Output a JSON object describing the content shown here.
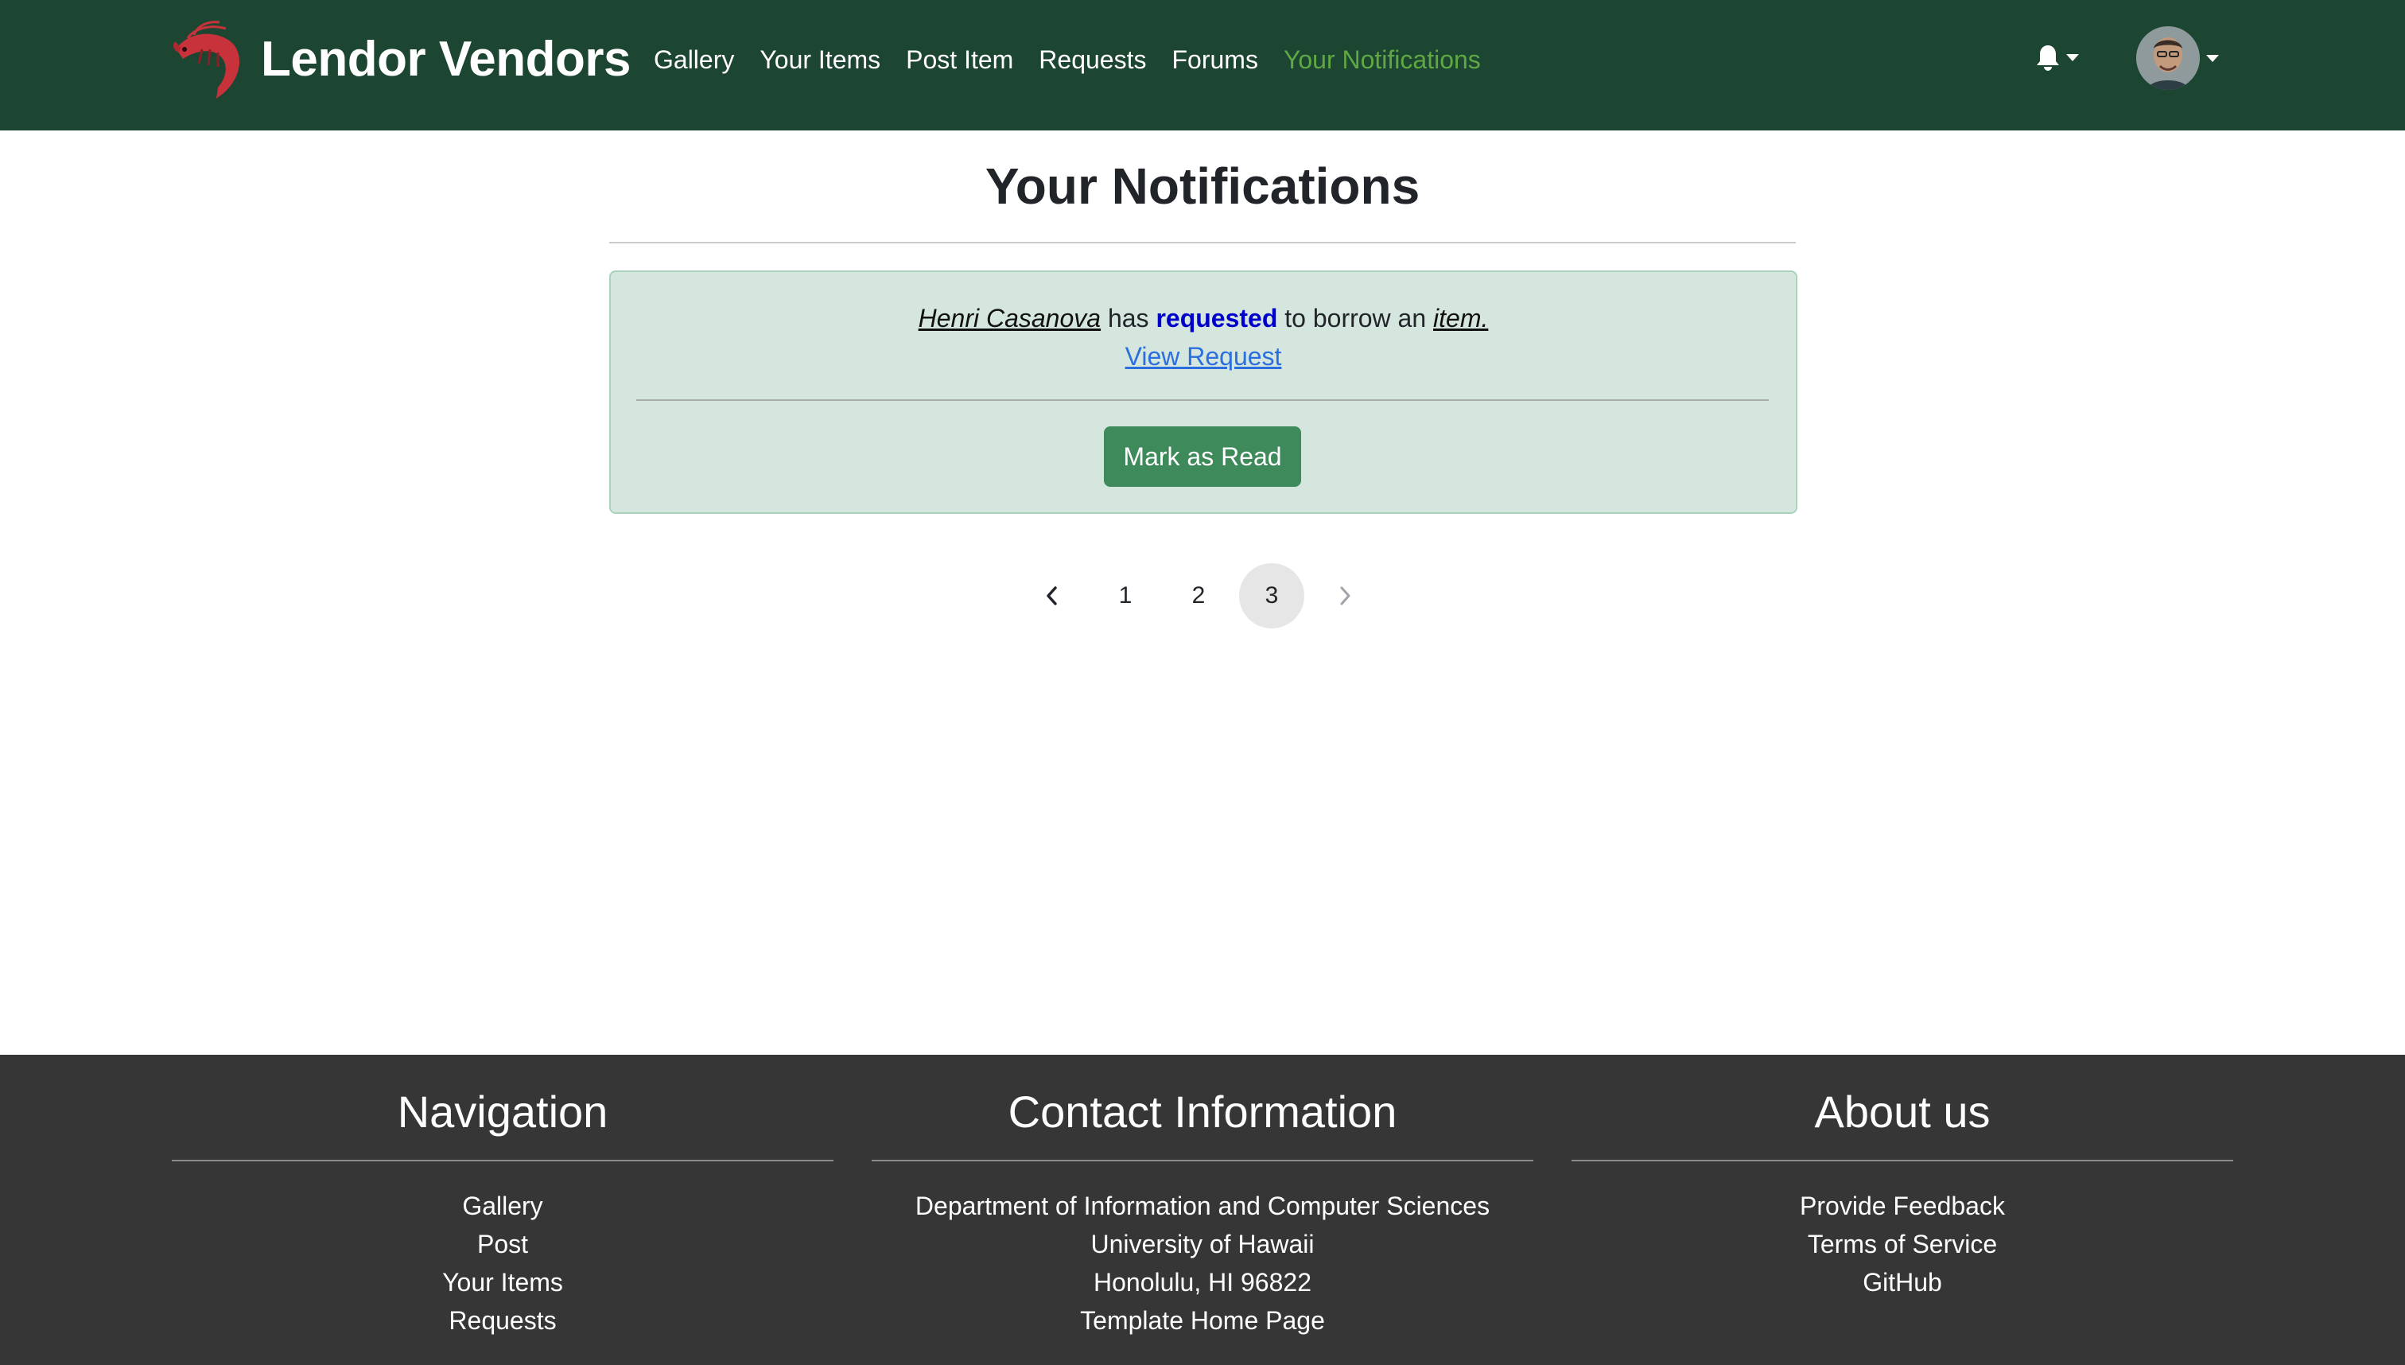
{
  "navbar": {
    "brand": "Lendor Vendors",
    "links": [
      "Gallery",
      "Your Items",
      "Post Item",
      "Requests",
      "Forums",
      "Your Notifications"
    ],
    "active_link": "Your Notifications",
    "brand_logo": "shrimp-logo",
    "notification_icon": "bell-icon",
    "avatar": "user-avatar"
  },
  "main": {
    "title": "Your Notifications",
    "notification": {
      "user": "Henri Casanova",
      "text_has": "has",
      "action": "requested",
      "text_middle": "to borrow an",
      "item": "item.",
      "view_link": "View Request",
      "mark_button": "Mark as Read"
    },
    "pagination": {
      "pages": [
        "1",
        "2",
        "3"
      ],
      "current": "3",
      "prev_icon": "chevron-left-icon",
      "next_icon": "chevron-right-icon"
    }
  },
  "footer": {
    "navigation": {
      "title": "Navigation",
      "items": [
        "Gallery",
        "Post",
        "Your Items",
        "Requests"
      ]
    },
    "contact": {
      "title": "Contact Information",
      "lines": [
        "Department of Information and Computer Sciences",
        "University of Hawaii",
        "Honolulu, HI 96822",
        "Template Home Page"
      ]
    },
    "about": {
      "title": "About us",
      "items": [
        "Provide Feedback",
        "Terms of Service",
        "GitHub"
      ]
    }
  },
  "colors": {
    "navbar_bg": "#1c4532",
    "active_link": "#5fa843",
    "card_bg": "#d4e6dd",
    "button_bg": "#3f8a5a",
    "footer_bg": "#363636",
    "link_blue": "#2b6fde",
    "requested_blue": "#0000cc"
  }
}
